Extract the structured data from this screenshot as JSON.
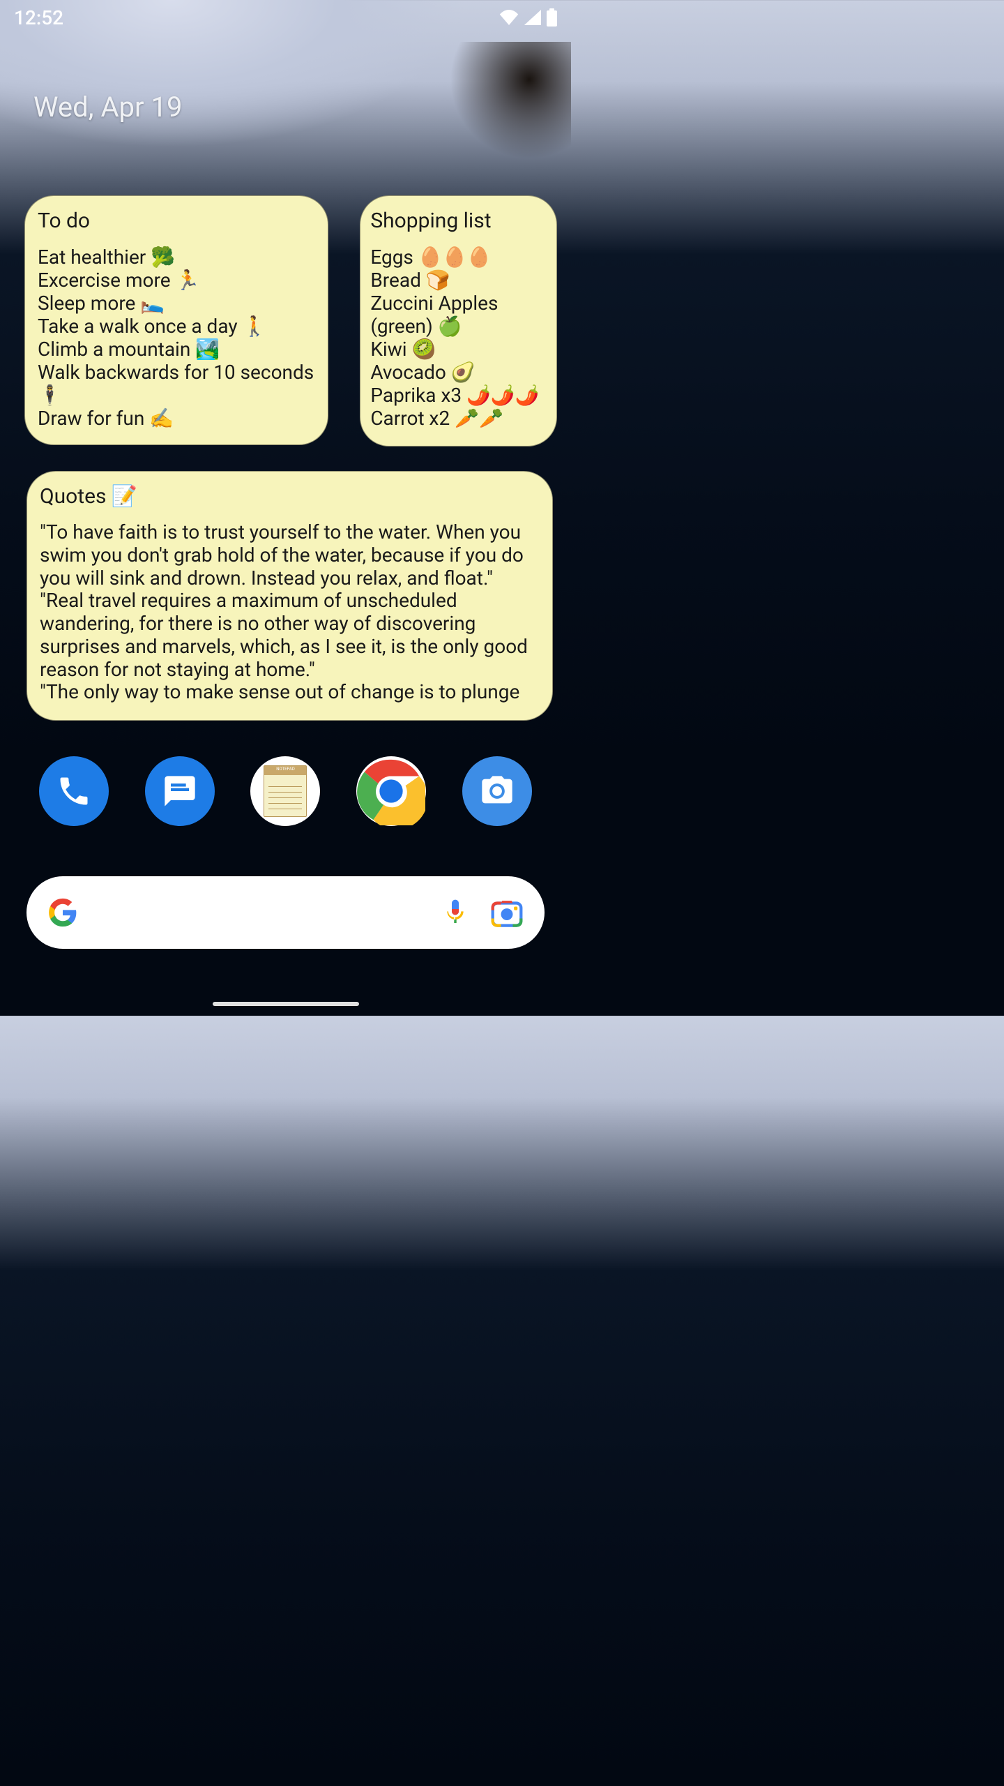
{
  "statusBar": {
    "time": "12:52"
  },
  "date": "Wed, Apr 19",
  "widgets": {
    "todo": {
      "title": "To do",
      "items": [
        "Eat healthier 🥦",
        "Excercise more 🏃",
        "Sleep more 🛌",
        "Take a walk once a day 🚶",
        "Climb a mountain 🏞️",
        "Walk backwards for 10 seconds 🕴️",
        "Draw for fun ✍️"
      ]
    },
    "shopping": {
      "title": "Shopping list",
      "items": [
        "Eggs 🥚🥚🥚",
        "Bread 🍞",
        "Zuccini Apples (green) 🍏",
        "Kiwi 🥝",
        "Avocado 🥑",
        "Paprika x3 🌶️🌶️🌶️",
        "Carrot x2 🥕🥕"
      ]
    },
    "quotes": {
      "title": "Quotes 📝",
      "content": "\"To have faith is to trust yourself to the water. When you swim you don't grab hold of the water, because if you do you will sink and drown. Instead you relax, and float.\"\n\"Real travel requires a maximum of unscheduled wandering, for there is no other way of discovering surprises and marvels, which, as I see it, is the only good reason for not staying at home.\"\n\"The only way to make sense out of change is to plunge"
    }
  },
  "apps": {
    "phone": "Phone",
    "messages": "Messages",
    "notepad": "Notepad",
    "chrome": "Chrome",
    "camera": "Camera"
  }
}
